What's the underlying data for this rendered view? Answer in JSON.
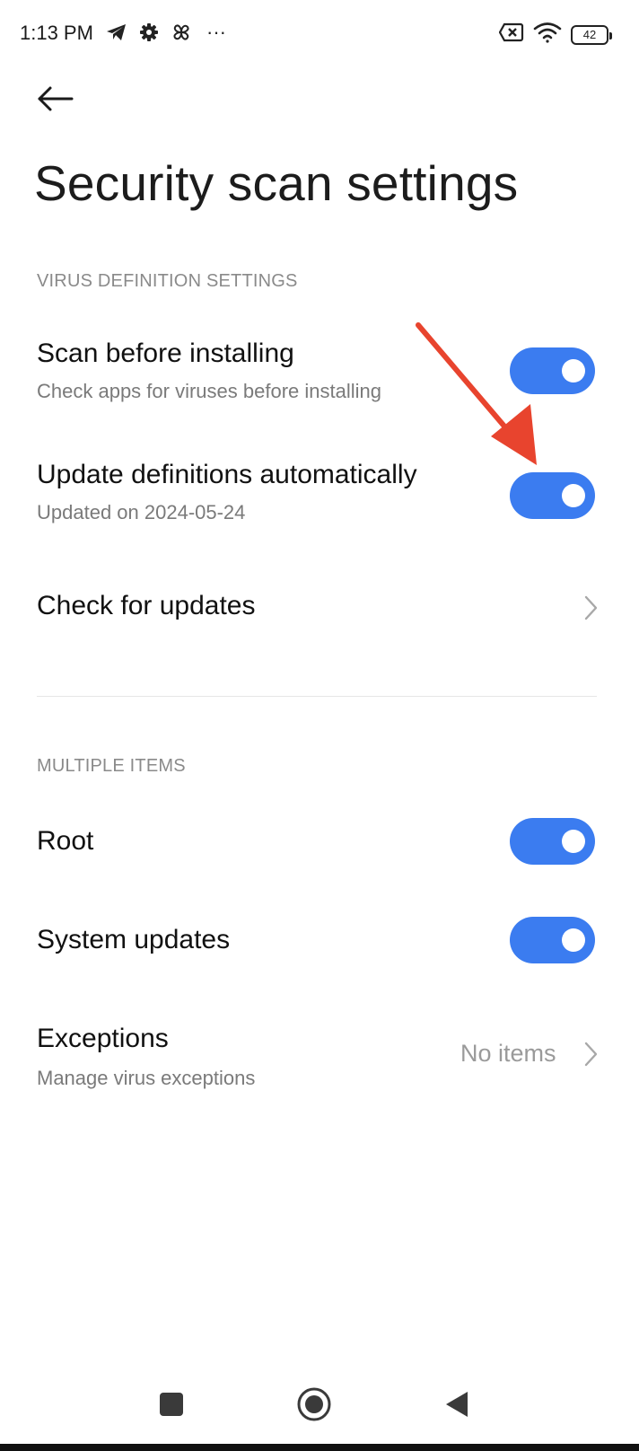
{
  "status_bar": {
    "time": "1:13 PM",
    "left_icons": [
      "telegram-icon",
      "gear-icon",
      "pinwheel-icon",
      "more-dots-icon"
    ],
    "more_label": "···",
    "right_icons": [
      "sim-off-icon",
      "wifi-icon",
      "battery-icon"
    ],
    "battery_level": "42"
  },
  "header": {
    "back_icon": "arrow-left-icon",
    "title": "Security scan settings"
  },
  "sections": [
    {
      "header": "VIRUS DEFINITION SETTINGS",
      "items": [
        {
          "title": "Scan before installing",
          "subtitle": "Check apps for viruses before installing",
          "control": "toggle",
          "enabled": true
        },
        {
          "title": "Update definitions automatically",
          "subtitle": "Updated on 2024-05-24",
          "control": "toggle",
          "enabled": true
        },
        {
          "title": "Check for updates",
          "control": "chevron"
        }
      ]
    },
    {
      "header": "MULTIPLE ITEMS",
      "items": [
        {
          "title": "Root",
          "control": "toggle",
          "enabled": true
        },
        {
          "title": "System updates",
          "control": "toggle",
          "enabled": true
        },
        {
          "title": "Exceptions",
          "subtitle": "Manage virus exceptions",
          "value": "No items",
          "control": "chevron"
        }
      ]
    }
  ],
  "annotation": {
    "type": "arrow",
    "color": "#e8442e",
    "points_to": "Update definitions automatically toggle"
  },
  "colors": {
    "accent": "#3b7cf0",
    "section_header": "#8a8a8a",
    "subtitle": "#7a7a7a"
  },
  "nav_bar": {
    "buttons": [
      "recents-square-icon",
      "home-circle-icon",
      "back-triangle-icon"
    ]
  }
}
